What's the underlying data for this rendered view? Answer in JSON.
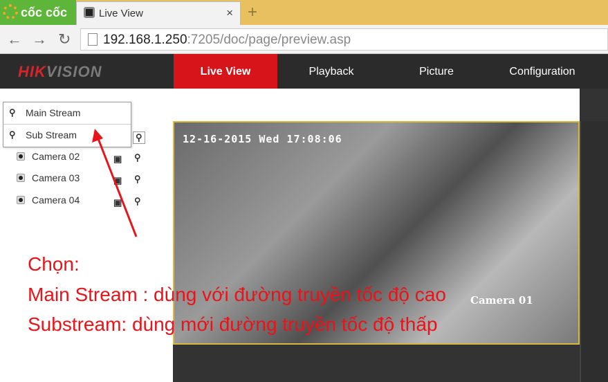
{
  "browser": {
    "brand": "cốc cốc",
    "tab_title": "Live View",
    "tab_close": "×",
    "new_tab": "+",
    "url_host": "192.168.1.250",
    "url_rest": ":7205/doc/page/preview.asp",
    "back": "←",
    "forward": "→",
    "reload": "↻"
  },
  "app": {
    "logo_hik": "HIK",
    "logo_vision": "VISION",
    "nav": [
      {
        "label": "Live View",
        "active": true
      },
      {
        "label": "Playback"
      },
      {
        "label": "Picture"
      },
      {
        "label": "Configuration"
      }
    ]
  },
  "stream_menu": [
    {
      "label": "Main Stream",
      "icon": "main-stream-icon"
    },
    {
      "label": "Sub Stream",
      "icon": "sub-stream-icon"
    }
  ],
  "cameras": [
    {
      "label": "Camera 02"
    },
    {
      "label": "Camera 03"
    },
    {
      "label": "Camera 04"
    }
  ],
  "video": {
    "timestamp": "12-16-2015 Wed 17:08:06",
    "camera_label": "Camera 01"
  },
  "annotation": {
    "color": "#e8141a",
    "lines": [
      "Chọn:",
      "Main Stream : dùng với đường truyền tốc độ cao",
      "Substream: dùng mới đường truyền tốc độ thấp"
    ]
  },
  "colors": {
    "accent": "#d7141a",
    "nav_bg": "#2b2b2b"
  }
}
